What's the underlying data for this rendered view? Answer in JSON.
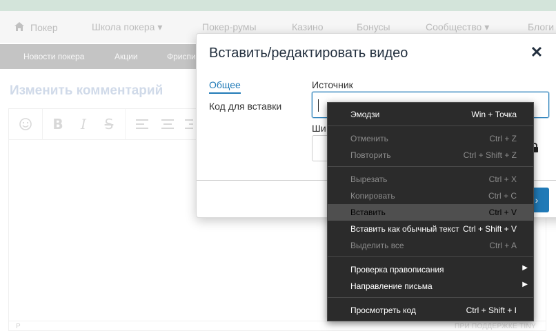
{
  "nav": {
    "home": "Покер",
    "items": [
      "Школа покера ▾",
      "Покер-румы",
      "Казино",
      "Бонусы",
      "Сообщество ▾",
      "Блоги"
    ]
  },
  "subnav": {
    "items": [
      "Новости покера",
      "Акции",
      "Фриспи"
    ]
  },
  "page": {
    "title": "Изменить комментарий"
  },
  "editor": {
    "status_path": "P",
    "status_brand": "ПРИ ПОДДЕРЖКЕ TINY"
  },
  "dialog": {
    "title": "Вставить/редактировать видео",
    "close": "✕",
    "tabs": [
      "Общее",
      "Код для вставки"
    ],
    "source_label": "Источник",
    "source_value": "",
    "width_label": "Ши",
    "save_label": "›"
  },
  "context_menu": {
    "items": [
      {
        "label": "Эмодзи",
        "shortcut": "Win + Точка",
        "state": "enabled"
      },
      {
        "label": "Отменить",
        "shortcut": "Ctrl + Z",
        "state": "disabled"
      },
      {
        "label": "Повторить",
        "shortcut": "Ctrl + Shift + Z",
        "state": "disabled"
      },
      {
        "label": "Вырезать",
        "shortcut": "Ctrl + X",
        "state": "disabled"
      },
      {
        "label": "Копировать",
        "shortcut": "Ctrl + C",
        "state": "disabled"
      },
      {
        "label": "Вставить",
        "shortcut": "Ctrl + V",
        "state": "highlighted"
      },
      {
        "label": "Вставить как обычный текст",
        "shortcut": "Ctrl + Shift + V",
        "state": "enabled"
      },
      {
        "label": "Выделить все",
        "shortcut": "Ctrl + A",
        "state": "disabled"
      },
      {
        "label": "Проверка правописания",
        "shortcut": "",
        "state": "enabled",
        "submenu": true
      },
      {
        "label": "Направление письма",
        "shortcut": "",
        "state": "enabled",
        "submenu": true
      },
      {
        "label": "Просмотреть код",
        "shortcut": "Ctrl + Shift + I",
        "state": "enabled"
      }
    ]
  },
  "colors": {
    "accent": "#207ab7",
    "menu_bg": "#2b2b2b",
    "menu_highlight": "#4f4f4f"
  }
}
